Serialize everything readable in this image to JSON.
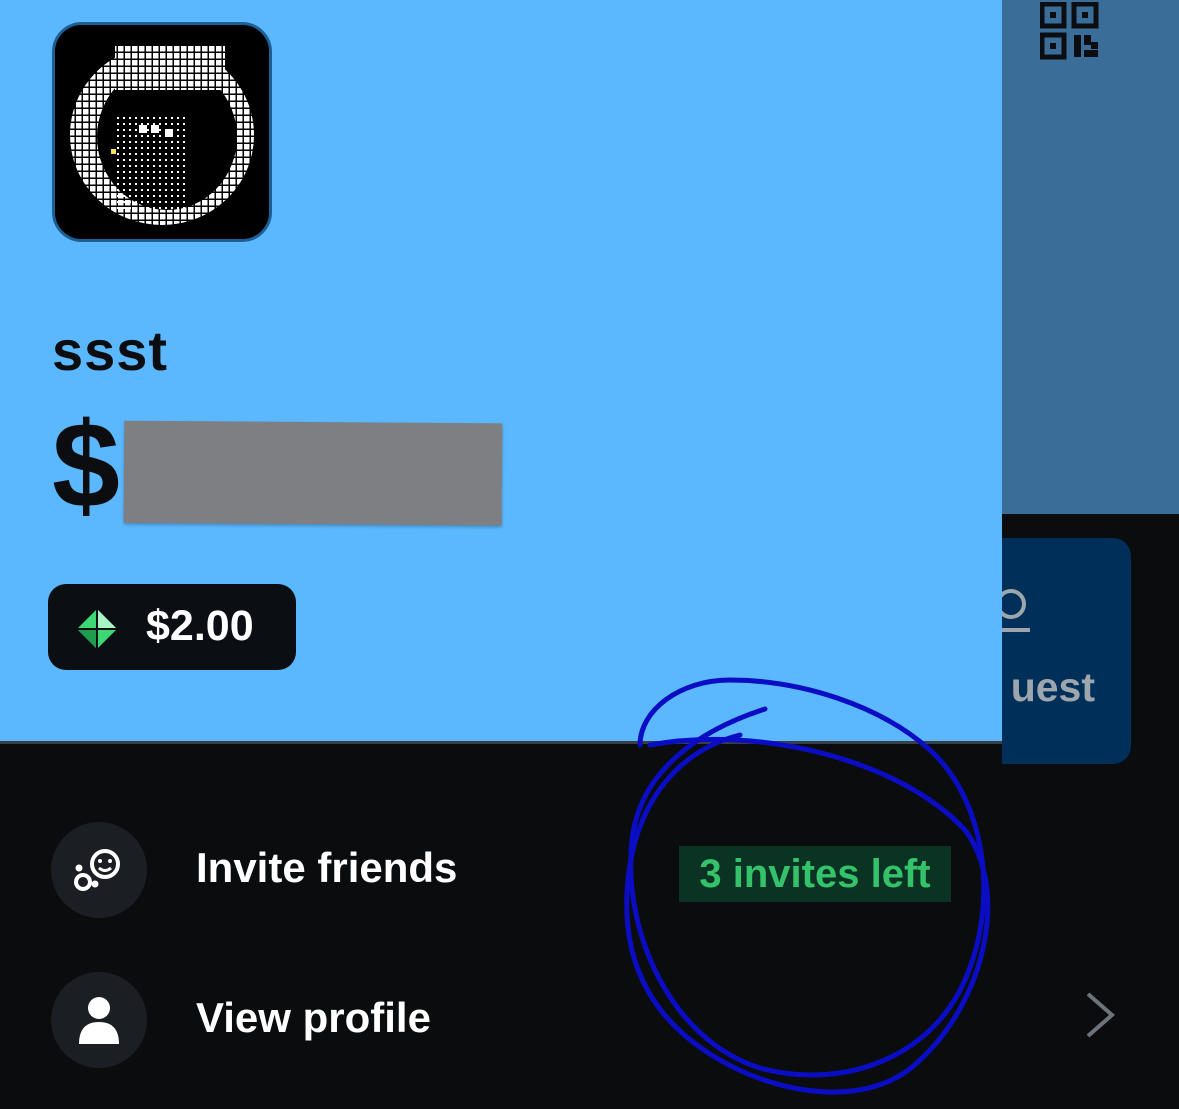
{
  "profile": {
    "display_name": "ssst",
    "cashtag_prefix": "$",
    "balance": "$2.00"
  },
  "menu": [
    {
      "label": "Invite friends",
      "badge": "3 invites left",
      "icon": "invite-friends-icon"
    },
    {
      "label": "View profile",
      "icon": "person-icon"
    }
  ],
  "background": {
    "request_label": "uest",
    "icons": [
      "qr-code-icon",
      "chevron-right-icon",
      "request-icon"
    ]
  },
  "colors": {
    "header_bg": "#5cb8fe",
    "drawer_bg": "#0a0c0e",
    "badge_bg": "#0a3323",
    "badge_text": "#34c26b",
    "annotation": "#0b0dc4"
  }
}
